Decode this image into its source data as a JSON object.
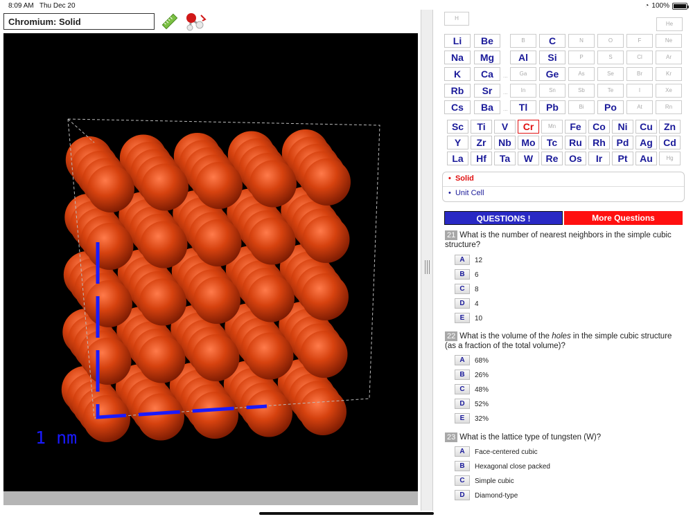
{
  "status": {
    "time": "8:09 AM",
    "date": "Thu Dec 20",
    "battery": "100%"
  },
  "viewer": {
    "title": "Chromium: Solid",
    "scale_label": "1 nm"
  },
  "table": {
    "main_row1": [
      {
        "s": "H",
        "dim": true
      },
      {
        "s": "He",
        "dim": true
      }
    ],
    "rows": [
      [
        "Li",
        "Be",
        "B",
        "C",
        "N",
        "O",
        "F",
        "Ne"
      ],
      [
        "Na",
        "Mg",
        "Al",
        "Si",
        "P",
        "S",
        "Cl",
        "Ar"
      ],
      [
        "K",
        "Ca",
        "Ga",
        "Ge",
        "As",
        "Se",
        "Br",
        "Kr"
      ],
      [
        "Rb",
        "Sr",
        "In",
        "Sn",
        "Sb",
        "Te",
        "I",
        "Xe"
      ],
      [
        "Cs",
        "Ba",
        "Tl",
        "Pb",
        "Bi",
        "Po",
        "At",
        "Rn"
      ]
    ],
    "transition": [
      [
        "Sc",
        "Ti",
        "V",
        "Cr",
        "Mn",
        "Fe",
        "Co",
        "Ni",
        "Cu",
        "Zn"
      ],
      [
        "Y",
        "Zr",
        "Nb",
        "Mo",
        "Tc",
        "Ru",
        "Rh",
        "Pd",
        "Ag",
        "Cd"
      ],
      [
        "La",
        "Hf",
        "Ta",
        "W",
        "Re",
        "Os",
        "Ir",
        "Pt",
        "Au",
        "Hg"
      ]
    ],
    "dim": [
      "B",
      "N",
      "O",
      "F",
      "Ne",
      "P",
      "S",
      "Cl",
      "Ar",
      "Ga",
      "As",
      "Se",
      "Br",
      "Kr",
      "In",
      "Sn",
      "Sb",
      "Te",
      "I",
      "Xe",
      "Bi",
      "At",
      "Rn",
      "Mn",
      "Hg"
    ],
    "selected": "Cr",
    "dots": "..."
  },
  "menu": {
    "solid": "Solid",
    "unit_cell": "Unit Cell"
  },
  "buttons": {
    "questions": "QUESTIONS !",
    "more": "More Questions"
  },
  "questions": [
    {
      "num": "21",
      "text": "What is the number of nearest neighbors in the simple cubic structure?",
      "options": [
        [
          "A",
          "12"
        ],
        [
          "B",
          "6"
        ],
        [
          "C",
          "8"
        ],
        [
          "D",
          "4"
        ],
        [
          "E",
          "10"
        ]
      ]
    },
    {
      "num": "22",
      "text_a": "What is the volume of the ",
      "text_em": "holes",
      "text_b": " in the simple cubic structure (as a fraction of the total volume)?",
      "options": [
        [
          "A",
          "68%"
        ],
        [
          "B",
          "26%"
        ],
        [
          "C",
          "48%"
        ],
        [
          "D",
          "52%"
        ],
        [
          "E",
          "32%"
        ]
      ]
    },
    {
      "num": "23",
      "text": "What is the lattice type of tungsten (W)?",
      "options": [
        [
          "A",
          "Face-centered cubic"
        ],
        [
          "B",
          "Hexagonal close packed"
        ],
        [
          "C",
          "Simple cubic"
        ],
        [
          "D",
          "Diamond-type"
        ]
      ]
    }
  ],
  "colors": {
    "atom": "#c93a12",
    "scale": "#1a1aff",
    "selected": "#e01010",
    "label": "#1a1a99"
  }
}
